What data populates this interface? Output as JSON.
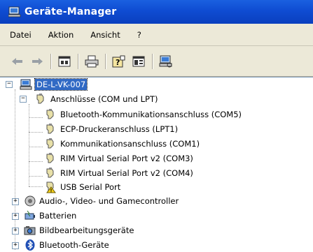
{
  "window": {
    "title": "Geräte-Manager"
  },
  "menu": {
    "items": [
      "Datei",
      "Aktion",
      "Ansicht",
      "?"
    ]
  },
  "toolbar": {
    "buttons": [
      "back-arrow-icon",
      "forward-arrow-icon",
      "properties-icon",
      "print-icon",
      "help-icon",
      "view-icon",
      "scan-hardware-icon"
    ]
  },
  "tree": {
    "root": {
      "label": "DE-L-VK-007",
      "expander": "−"
    },
    "ports": {
      "label": "Anschlüsse (COM und LPT)",
      "expander": "−",
      "children": [
        "Bluetooth-Kommunikationsanschluss (COM5)",
        "ECP-Druckeranschluss (LPT1)",
        "Kommunikationsanschluss (COM1)",
        "RIM Virtual Serial Port v2 (COM3)",
        "RIM Virtual Serial Port v2 (COM4)",
        "USB Serial Port"
      ]
    },
    "categories": [
      {
        "label": "Audio-, Video- und Gamecontroller",
        "expander": "+"
      },
      {
        "label": "Batterien",
        "expander": "+"
      },
      {
        "label": "Bildbearbeitungsgeräte",
        "expander": "+"
      },
      {
        "label": "Bluetooth-Geräte",
        "expander": "+"
      }
    ]
  }
}
